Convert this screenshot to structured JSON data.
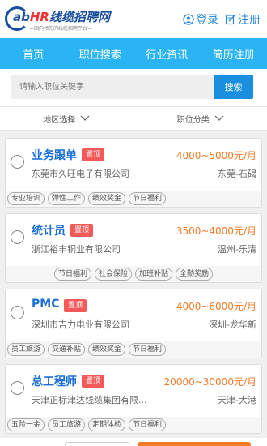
{
  "header": {
    "logo_brand_prefix": "ab",
    "logo_brand_hr": "HR",
    "logo_brand_name": "线缆招聘网",
    "logo_tagline": "—国内领先的线缆招聘平台—",
    "login_label": "登录",
    "register_label": "注册"
  },
  "nav": {
    "items": [
      {
        "label": "首页"
      },
      {
        "label": "职位搜索"
      },
      {
        "label": "行业资讯"
      },
      {
        "label": "简历注册"
      }
    ]
  },
  "search": {
    "placeholder": "请输入职位关键字",
    "button_label": "搜索"
  },
  "filters": {
    "region": "地区选择",
    "category": "职位分类"
  },
  "jobs": [
    {
      "title": "业务跟单",
      "badge": "置顶",
      "salary": "4000~5000元/月",
      "company": "东莞市久旺电子有限公司",
      "location": "东莞-石碣",
      "tags": [
        "专业培训",
        "弹性工作",
        "绩效奖金",
        "节日福利"
      ]
    },
    {
      "title": "统计员",
      "badge": "置顶",
      "salary": "3500~4000元/月",
      "company": "浙江裕丰铜业有限公司",
      "location": "温州-乐清",
      "tags": [
        "节日福利",
        "社会保险",
        "加班补贴",
        "全勤奖励"
      ]
    },
    {
      "title": "PMC",
      "badge": "置顶",
      "salary": "4000~6000元/月",
      "company": "深圳市吉力电业有限公司",
      "location": "深圳-龙华新",
      "tags": [
        "员工旅游",
        "交通补贴",
        "绩效奖金",
        "节日福利"
      ]
    },
    {
      "title": "总工程师",
      "badge": "置顶",
      "salary": "20000~30000元/月",
      "company": "天津正标津达线缆集团有限...",
      "location": "天津-大港",
      "tags": [
        "五险一金",
        "员工旅游",
        "定期体检",
        "节日福利"
      ]
    }
  ],
  "colors": {
    "nav_bg": "#2bb4f3",
    "primary_blue": "#1a8fe0",
    "salary_orange": "#f37a2a",
    "badge_red": "#f25a5a"
  }
}
